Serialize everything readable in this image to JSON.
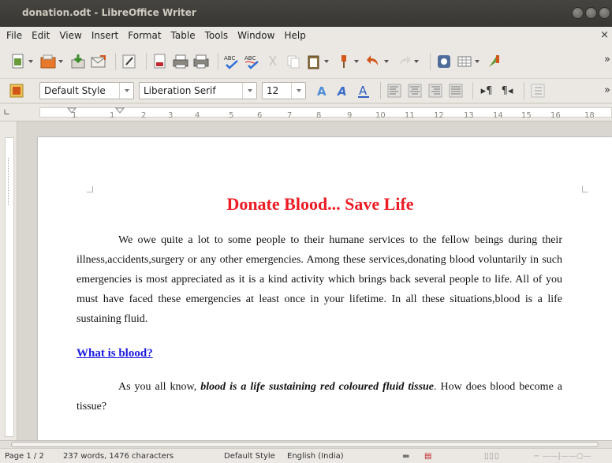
{
  "window": {
    "title": "donation.odt - LibreOffice Writer"
  },
  "menu": [
    "File",
    "Edit",
    "View",
    "Insert",
    "Format",
    "Table",
    "Tools",
    "Window",
    "Help"
  ],
  "formatting": {
    "paragraph_style": "Default Style",
    "font_name": "Liberation Serif",
    "font_size": "12"
  },
  "ruler": {
    "numbers": [
      "1",
      "1",
      "2",
      "3",
      "4",
      "5",
      "6",
      "7",
      "8",
      "9",
      "10",
      "11",
      "12",
      "13",
      "14",
      "15",
      "16",
      "18"
    ]
  },
  "document": {
    "title": "Donate Blood... Save Life",
    "paragraph1": "We owe quite a lot to some people to their humane services to the fellow beings during their illness,accidents,surgery or any other emergencies. Among these services,donating blood voluntarily in such emergencies is most appreciated as it is a kind activity which brings back several people to life. All of you must have faced these emergencies at least once in your lifetime. In all these situations,blood is a life sustaining fluid.",
    "heading1": "What is  blood?",
    "paragraph2_start": "As you all know, ",
    "paragraph2_bold": "blood is a life sustaining red coloured fluid tissue",
    "paragraph2_end": ". How does blood become a tissue?"
  },
  "status": {
    "page": "Page 1 / 2",
    "words": "237 words, 1476 characters",
    "style": "Default Style",
    "language": "English (India)"
  },
  "colors": {
    "title_red": "#ed1c24",
    "heading_blue": "#1a1ae0",
    "chrome": "#ebe8e3",
    "titlebar": "#3c3b37"
  }
}
